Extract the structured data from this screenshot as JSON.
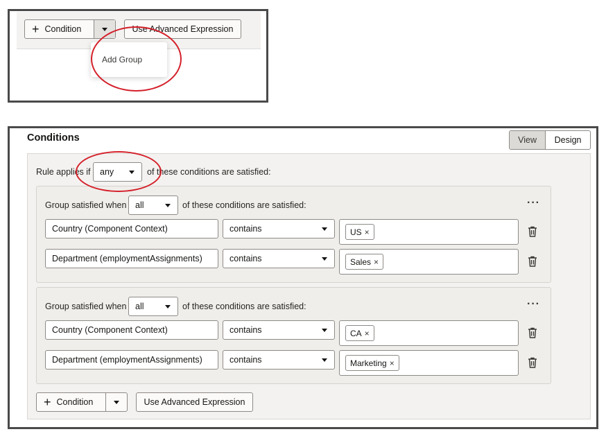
{
  "inset": {
    "condition_label": "Condition",
    "advanced_label": "Use Advanced Expression",
    "menu_item": "Add Group"
  },
  "main": {
    "title": "Conditions",
    "view_label": "View",
    "design_label": "Design",
    "rule_prefix": "Rule applies if",
    "rule_value": "any",
    "rule_suffix": "of these conditions are satisfied:",
    "groups": [
      {
        "prefix": "Group satisfied when",
        "value": "all",
        "suffix": "of these conditions are satisfied:",
        "rows": [
          {
            "field": "Country (Component Context)",
            "operator": "contains",
            "tag": "US"
          },
          {
            "field": "Department (employmentAssignments)",
            "operator": "contains",
            "tag": "Sales"
          }
        ]
      },
      {
        "prefix": "Group satisfied when",
        "value": "all",
        "suffix": "of these conditions are satisfied:",
        "rows": [
          {
            "field": "Country (Component Context)",
            "operator": "contains",
            "tag": "CA"
          },
          {
            "field": "Department (employmentAssignments)",
            "operator": "contains",
            "tag": "Marketing"
          }
        ]
      }
    ],
    "condition_label": "Condition",
    "advanced_label": "Use Advanced Expression"
  },
  "icons": {
    "remove": "×",
    "more": "···"
  },
  "colors": {
    "highlight_circle": "#d4202a",
    "panel_bg": "#f4f2f0",
    "group_bg": "#f0eeeb",
    "view_selected_bg": "#dcdad7"
  }
}
